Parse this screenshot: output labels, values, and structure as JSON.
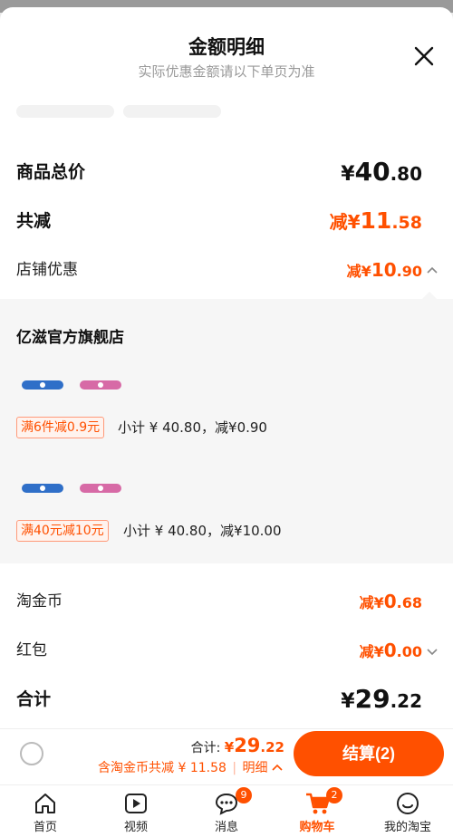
{
  "header": {
    "title": "金额明细",
    "subtitle": "实际优惠金额请以下单页为准"
  },
  "summary": {
    "goods_total": {
      "label": "商品总价",
      "yen": "¥",
      "int": "40",
      "dec": ".80"
    },
    "total_reduce": {
      "label": "共减",
      "prefix": "减¥",
      "int": "11",
      "dec": ".58"
    },
    "shop_discount": {
      "label": "店铺优惠",
      "prefix": "减¥",
      "int": "10",
      "dec": ".90"
    }
  },
  "store": {
    "name": "亿滋官方旗舰店",
    "promos": [
      {
        "tag": "满6件减0.9元",
        "text": "小计 ¥ 40.80，减¥0.90"
      },
      {
        "tag": "满40元减10元",
        "text": "小计 ¥ 40.80，减¥10.00"
      }
    ]
  },
  "extras": {
    "coins": {
      "label": "淘金币",
      "prefix": "减¥",
      "int": "0",
      "dec": ".68"
    },
    "redpack": {
      "label": "红包",
      "prefix": "减¥",
      "int": "0",
      "dec": ".00"
    },
    "total": {
      "label": "合计",
      "yen": "¥",
      "int": "29",
      "dec": ".22"
    }
  },
  "footer": {
    "sum_label": "合计:",
    "sum_yen": "¥",
    "sum_int": "29",
    "sum_dec": ".22",
    "coin_note": "含淘金币共减 ¥ 11.58",
    "sep": "|",
    "detail_label": "明细",
    "checkout_label": "结算(2)"
  },
  "tabs": [
    {
      "label": "首页",
      "icon": "home-icon"
    },
    {
      "label": "视频",
      "icon": "video-icon"
    },
    {
      "label": "消息",
      "icon": "message-icon",
      "badge": "9"
    },
    {
      "label": "购物车",
      "icon": "cart-icon",
      "badge": "2",
      "active": true
    },
    {
      "label": "我的淘宝",
      "icon": "profile-icon"
    }
  ],
  "colors": {
    "accent": "#ff5000",
    "muted": "#999999"
  }
}
